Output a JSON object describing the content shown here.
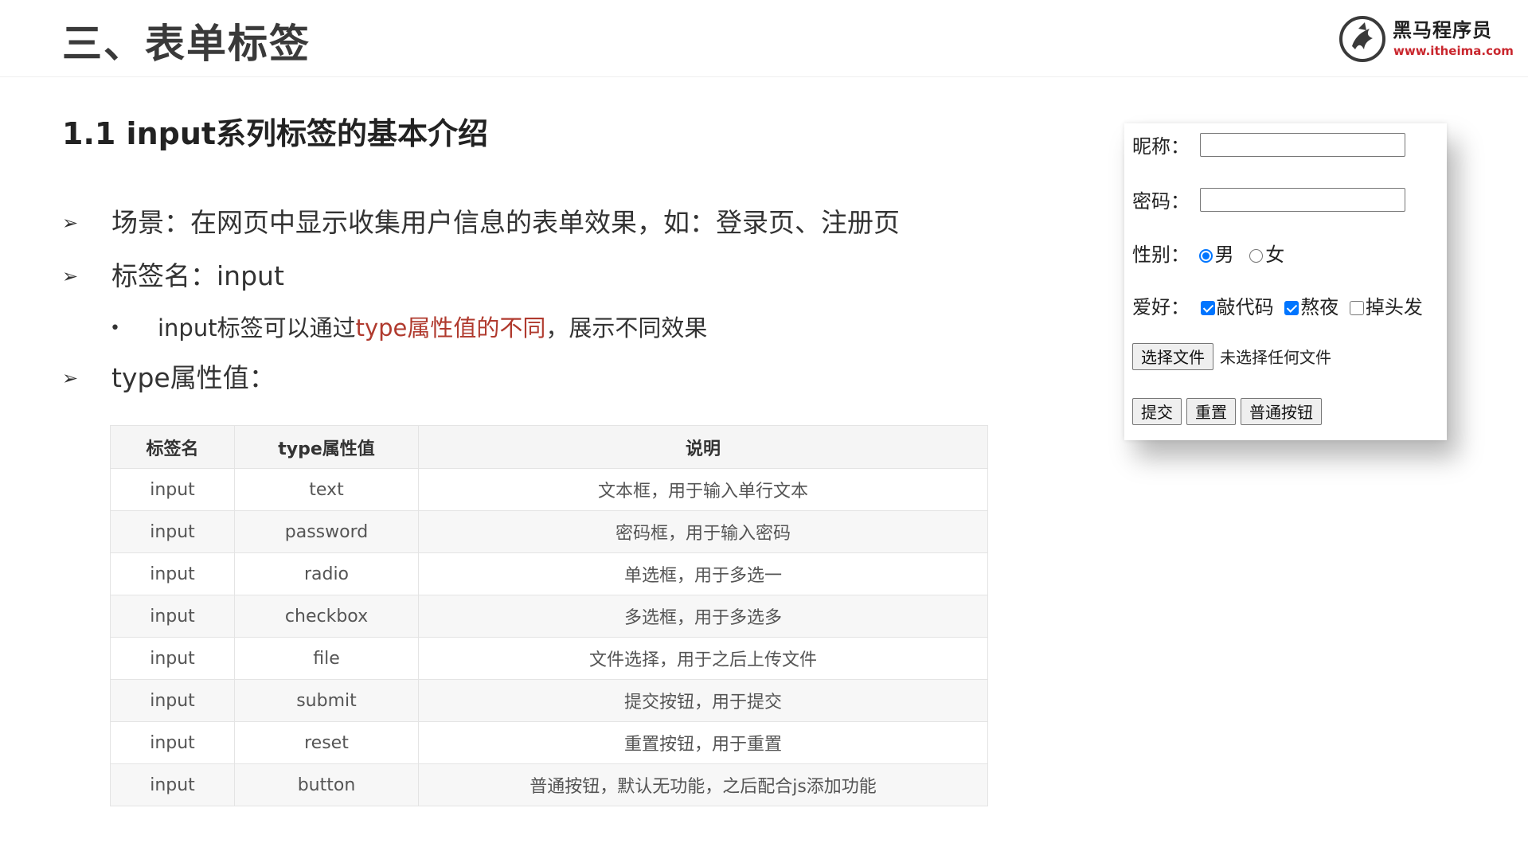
{
  "header": {
    "title": "三、表单标签",
    "logo_name": "黑马程序员",
    "logo_url": "www.itheima.com"
  },
  "section": {
    "title": "1.1 input系列标签的基本介绍"
  },
  "bullets": {
    "scene": "场景：在网页中显示收集用户信息的表单效果，如：登录页、注册页",
    "tag_name": "标签名：input",
    "sub_prefix": "input标签可以通过",
    "sub_highlight": "type属性值的不同",
    "sub_suffix": "，展示不同效果",
    "type_values": "type属性值："
  },
  "table": {
    "headers": [
      "标签名",
      "type属性值",
      "说明"
    ],
    "rows": [
      [
        "input",
        "text",
        "文本框，用于输入单行文本"
      ],
      [
        "input",
        "password",
        "密码框，用于输入密码"
      ],
      [
        "input",
        "radio",
        "单选框，用于多选一"
      ],
      [
        "input",
        "checkbox",
        "多选框，用于多选多"
      ],
      [
        "input",
        "file",
        "文件选择，用于之后上传文件"
      ],
      [
        "input",
        "submit",
        "提交按钮，用于提交"
      ],
      [
        "input",
        "reset",
        "重置按钮，用于重置"
      ],
      [
        "input",
        "button",
        "普通按钮，默认无功能，之后配合js添加功能"
      ]
    ]
  },
  "demo_form": {
    "nickname_label": "昵称：",
    "password_label": "密码：",
    "gender_label": "性别：",
    "gender_options": [
      "男",
      "女"
    ],
    "gender_selected": "男",
    "hobby_label": "爱好：",
    "hobbies": [
      {
        "label": "敲代码",
        "checked": true
      },
      {
        "label": "熬夜",
        "checked": true
      },
      {
        "label": "掉头发",
        "checked": false
      }
    ],
    "file_button": "选择文件",
    "file_status": "未选择任何文件",
    "submit_button": "提交",
    "reset_button": "重置",
    "normal_button": "普通按钮"
  },
  "colors": {
    "highlight": "#b03a2e",
    "logo_red": "#c9262d",
    "check_blue": "#0075ff"
  }
}
